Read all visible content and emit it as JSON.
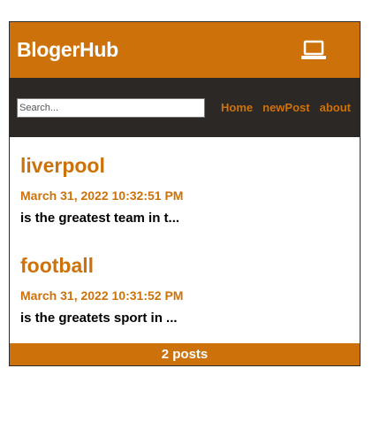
{
  "header": {
    "brand": "BlogerHub",
    "icon": "laptop-icon"
  },
  "nav": {
    "search_placeholder": "Search...",
    "links": [
      "Home",
      "newPost",
      "about"
    ]
  },
  "posts": [
    {
      "title": "liverpool",
      "date": "March 31, 2022 10:32:51 PM",
      "excerpt": "is the greatest team in t..."
    },
    {
      "title": "football",
      "date": "March 31, 2022 10:31:52 PM",
      "excerpt": "is the greatets sport in ..."
    }
  ],
  "footer": {
    "count_text": "2 posts"
  },
  "colors": {
    "accent": "#cd720a",
    "nav_bg": "#2c2826",
    "text": "#000000"
  }
}
